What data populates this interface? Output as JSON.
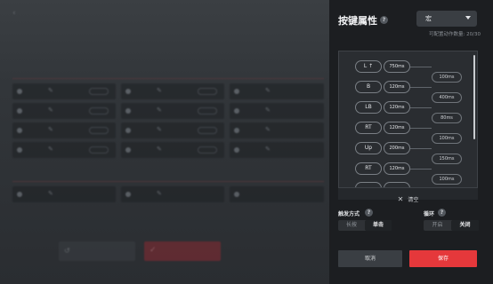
{
  "background": {
    "back_icon": "chevron-left-icon",
    "tabs": [
      "",
      "",
      ""
    ],
    "sections": [
      "",
      ""
    ],
    "reset_icon": "undo-icon",
    "apply_icon": "check-icon"
  },
  "panel": {
    "title": "按键属性",
    "help_glyph": "?",
    "mode_select": {
      "value": "宏",
      "icon": "caret-down-icon"
    },
    "count_text": "可配置动作数量: 20/30",
    "actions": [
      {
        "key": "L ↑",
        "duration": "750ms"
      },
      {
        "key": "B",
        "duration": "120ms"
      },
      {
        "key": "LB",
        "duration": "120ms"
      },
      {
        "key": "RT",
        "duration": "120ms"
      },
      {
        "key": "Up",
        "duration": "200ms"
      },
      {
        "key": "RT",
        "duration": "120ms"
      }
    ],
    "gaps": [
      "100ms",
      "400ms",
      "80ms",
      "100ms",
      "150ms",
      "100ms"
    ],
    "clear_label": "清空",
    "clear_icon": "close-icon",
    "trigger": {
      "label": "触发方式",
      "options": [
        "长按",
        "单击"
      ],
      "selected": 1
    },
    "loop": {
      "label": "循环",
      "options": [
        "开启",
        "关闭"
      ],
      "selected": 1
    },
    "cancel_label": "取消",
    "save_label": "保存",
    "colors": {
      "accent": "#e5383b",
      "panel_bg": "#1c1e21"
    }
  }
}
